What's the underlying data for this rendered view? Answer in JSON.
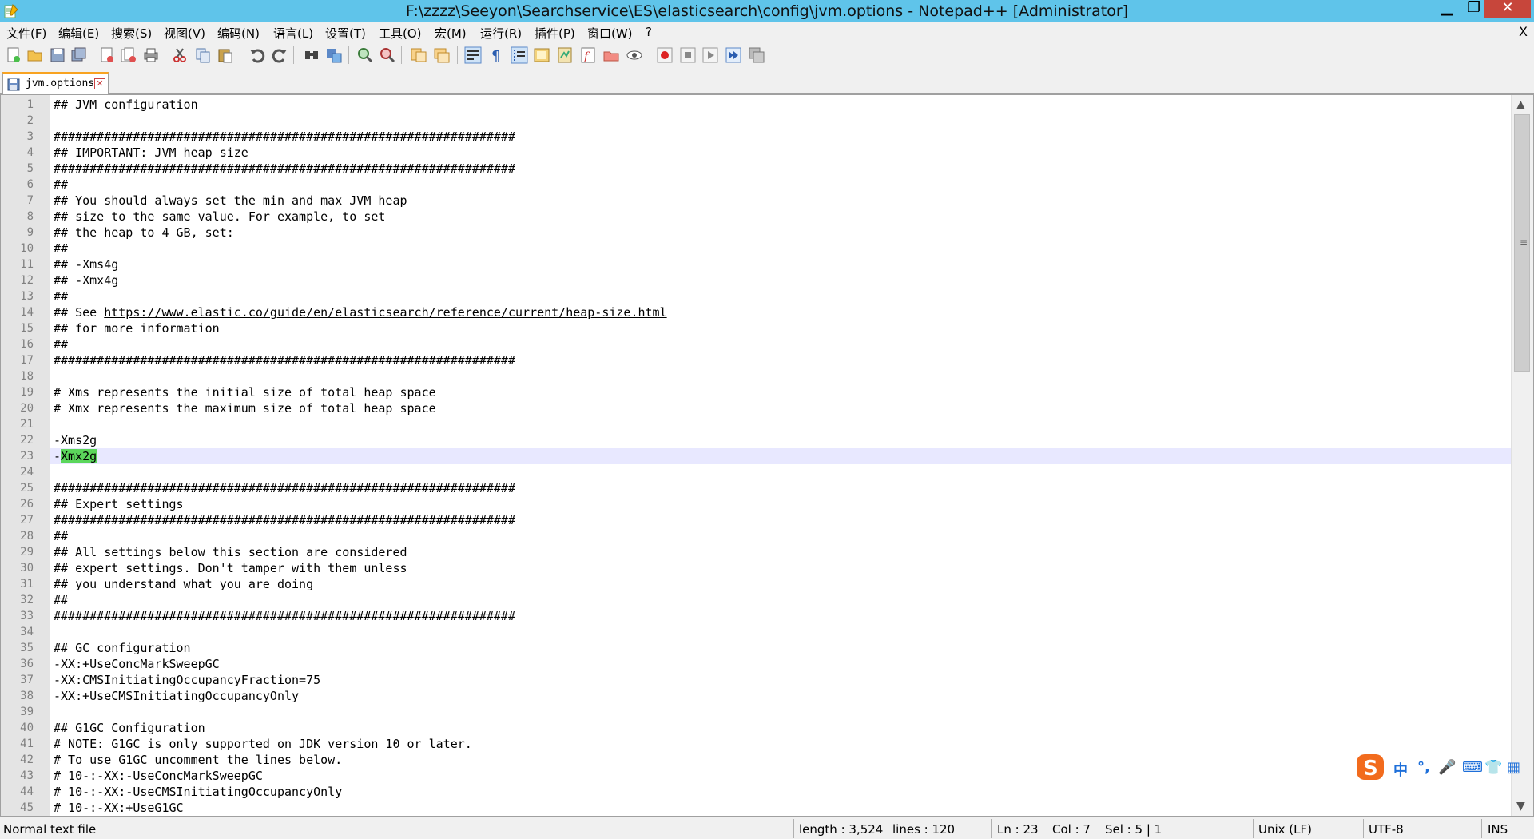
{
  "window": {
    "title": "F:\\zzzz\\Seeyon\\Searchservice\\ES\\elasticsearch\\config\\jvm.options - Notepad++ [Administrator]",
    "minimize": "▁",
    "maximize": "❐",
    "close": "✕"
  },
  "menu": {
    "items": [
      "文件(F)",
      "编辑(E)",
      "搜索(S)",
      "视图(V)",
      "编码(N)",
      "语言(L)",
      "设置(T)",
      "工具(O)",
      "宏(M)",
      "运行(R)",
      "插件(P)",
      "窗口(W)",
      "?"
    ],
    "close": "X"
  },
  "toolbar": {
    "icons": [
      "new-file-icon",
      "open-file-icon",
      "save-icon",
      "save-all-icon",
      "close-icon",
      "close-all-icon",
      "print-icon",
      "cut-icon",
      "copy-icon",
      "paste-icon",
      "undo-icon",
      "redo-icon",
      "find-icon",
      "replace-icon",
      "zoom-in-icon",
      "zoom-out-icon",
      "sync-vertical-icon",
      "sync-horizontal-icon",
      "word-wrap-icon",
      "show-all-chars-icon",
      "indent-guide-icon",
      "user-lang-icon",
      "doc-map-icon",
      "function-list-icon",
      "folder-workspace-icon",
      "monitoring-icon",
      "record-macro-icon",
      "stop-macro-icon",
      "play-macro-icon",
      "run-macro-multiple-icon",
      "save-macro-icon"
    ]
  },
  "tab": {
    "label": "jvm.options",
    "close": "✕"
  },
  "editor": {
    "current_line": 23,
    "lines": [
      "## JVM configuration",
      "",
      "################################################################",
      "## IMPORTANT: JVM heap size",
      "################################################################",
      "##",
      "## You should always set the min and max JVM heap",
      "## size to the same value. For example, to set",
      "## the heap to 4 GB, set:",
      "##",
      "## -Xms4g",
      "## -Xmx4g",
      "##",
      "## See https://www.elastic.co/guide/en/elasticsearch/reference/current/heap-size.html",
      "## for more information",
      "##",
      "################################################################",
      "",
      "# Xms represents the initial size of total heap space",
      "# Xmx represents the maximum size of total heap space",
      "",
      "-Xms2g",
      "-Xmx2g",
      "",
      "################################################################",
      "## Expert settings",
      "################################################################",
      "##",
      "## All settings below this section are considered",
      "## expert settings. Don't tamper with them unless",
      "## you understand what you are doing",
      "##",
      "################################################################",
      "",
      "## GC configuration",
      "-XX:+UseConcMarkSweepGC",
      "-XX:CMSInitiatingOccupancyFraction=75",
      "-XX:+UseCMSInitiatingOccupancyOnly",
      "",
      "## G1GC Configuration",
      "# NOTE: G1GC is only supported on JDK version 10 or later.",
      "# To use G1GC uncomment the lines below.",
      "# 10-:-XX:-UseConcMarkSweepGC",
      "# 10-:-XX:-UseCMSInitiatingOccupancyOnly",
      "# 10-:-XX:+UseG1GC"
    ],
    "link_line": 14,
    "link_prefix": "## See ",
    "link_text": "https://www.elastic.co/guide/en/elasticsearch/reference/current/heap-size.html",
    "selection_line": 23,
    "selection_prefix": "-",
    "selection_text": "Xmx2g"
  },
  "status": {
    "file_type": "Normal text file",
    "length": "length : 3,524",
    "lines": "lines : 120",
    "ln": "Ln : 23",
    "col": "Col : 7",
    "sel": "Sel : 5 | 1",
    "eol": "Unix (LF)",
    "encoding": "UTF-8",
    "mode": "INS"
  },
  "ime": {
    "items": [
      "中",
      "°,",
      "🎤",
      "⌨",
      "👕",
      "▦"
    ]
  },
  "colors": {
    "titlebar": "#5fc4ea",
    "selection": "#5bd65b",
    "current_line": "#e8e8ff",
    "close_button": "#c7463b"
  }
}
